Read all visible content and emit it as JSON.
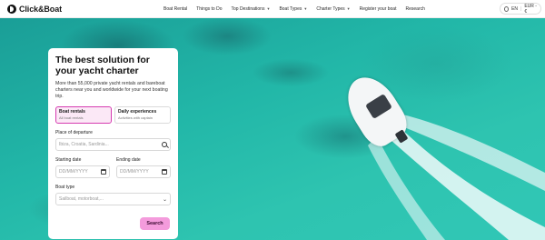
{
  "brand": {
    "name": "Click&Boat"
  },
  "nav": {
    "items": [
      {
        "label": "Boat Rental",
        "dropdown": false
      },
      {
        "label": "Things to Do",
        "dropdown": false
      },
      {
        "label": "Top Destinations",
        "dropdown": true
      },
      {
        "label": "Boat Types",
        "dropdown": true
      },
      {
        "label": "Charter Types",
        "dropdown": true
      },
      {
        "label": "Register your boat",
        "dropdown": false
      },
      {
        "label": "Research",
        "dropdown": false
      }
    ],
    "language": "EN",
    "currency": "EUR - €"
  },
  "search_card": {
    "title": "The best solution for your yacht charter",
    "subtitle": "More than 55,000 private yacht rentals and bareboat charters near you and worldwide for your next boating trip.",
    "tabs": [
      {
        "label": "Boat rentals",
        "sub": "All boat rentals",
        "active": true
      },
      {
        "label": "Daily experiences",
        "sub": "Activities with captain",
        "active": false
      }
    ],
    "departure_label": "Place of departure",
    "departure_placeholder": "Ibiza, Croatia, Sardinia...",
    "start_label": "Starting date",
    "start_placeholder": "DD/MM/YYYY",
    "end_label": "Ending date",
    "end_placeholder": "DD/MM/YYYY",
    "boat_type_label": "Boat type",
    "boat_type_placeholder": "Sailboat, motorboat,...",
    "search_button": "Search"
  },
  "colors": {
    "accent": "#f49bdc",
    "active_tab_border": "#d63bb0",
    "sea": "#22b7a8"
  }
}
